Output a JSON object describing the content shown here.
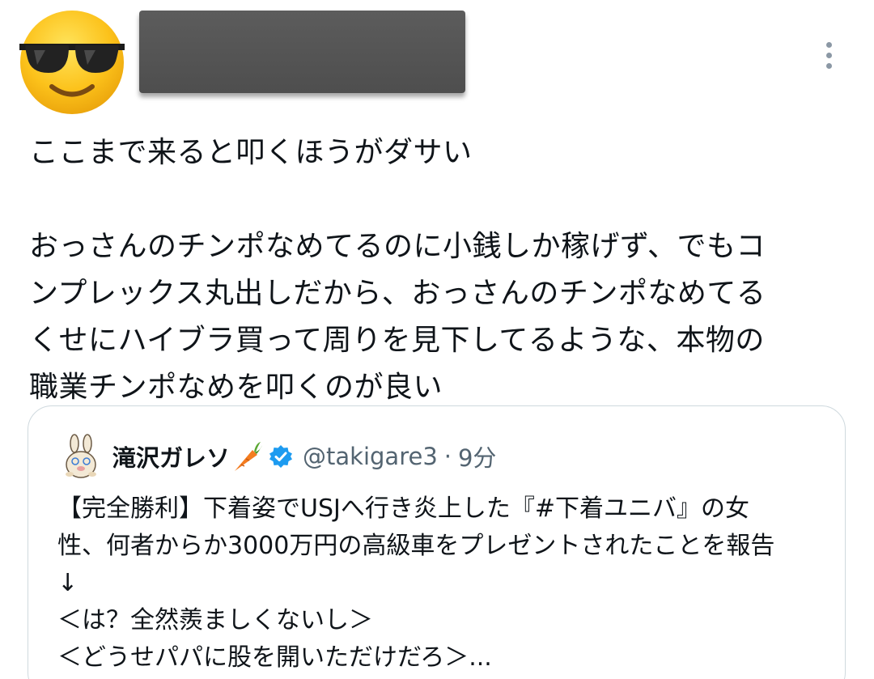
{
  "icons": {
    "avatar": "sunglasses-emoji",
    "more": "vertical-ellipsis-icon",
    "quote_avatar": "rabbit-mascot",
    "carrot": "carrot-emoji",
    "verified": "blue-verified-badge"
  },
  "colors": {
    "text": "#0f1419",
    "secondary": "#536471",
    "border": "#cfd9de",
    "verified": "#1d9bf0",
    "redaction": "#555555"
  },
  "tweet": {
    "lines": [
      "ここまで来ると叩くほうがダサい",
      "",
      "おっさんのチンポなめてるのに小銭しか稼げず、でもコ",
      "ンプレックス丸出しだから、おっさんのチンポなめてる",
      "くせにハイブラ買って周りを見下してるような、本物の",
      "職業チンポなめを叩くのが良い"
    ]
  },
  "quote": {
    "name": "滝沢ガレソ",
    "handle": "@takigare3",
    "separator": "·",
    "time": "9分",
    "lines": [
      "【完全勝利】下着姿でUSJへ行き炎上した『#下着ユニバ』の女",
      "性、何者からか3000万円の高級車をプレゼントされたことを報告",
      "↓",
      "＜は？全然羨ましくないし＞",
      "＜どうせパパに股を開いただけだろ＞..."
    ]
  }
}
